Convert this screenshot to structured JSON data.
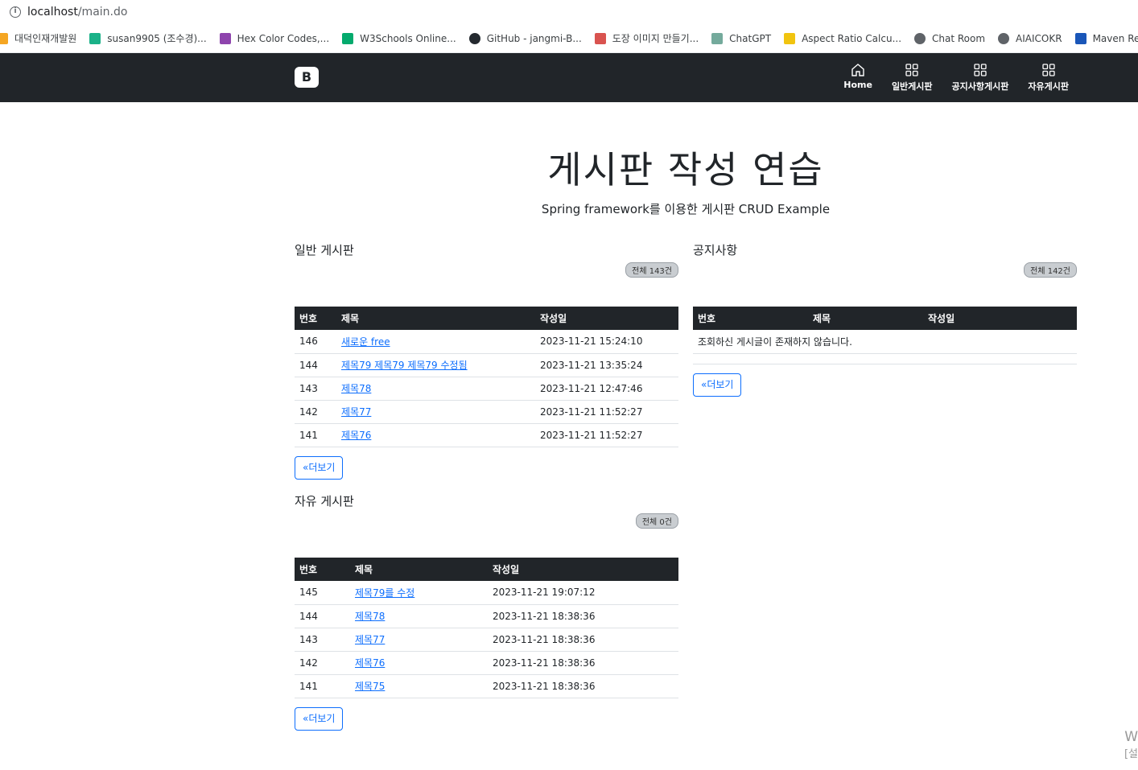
{
  "browser": {
    "url_host": "localhost",
    "url_path": "/main.do"
  },
  "bookmarks": [
    {
      "label": "대덕인재개발원",
      "icon": "bookmark-diagonal-icon",
      "color": "#f5a623"
    },
    {
      "label": "susan9905 (조수경)...",
      "icon": "v-icon",
      "color": "#1ab188"
    },
    {
      "label": "Hex Color Codes,...",
      "icon": "palette-icon",
      "color": "#8e44ad"
    },
    {
      "label": "W3Schools Online...",
      "icon": "w3-icon",
      "color": "#04aa6d"
    },
    {
      "label": "GitHub - jangmi-B...",
      "icon": "github-icon",
      "color": "#24292f"
    },
    {
      "label": "도장 이미지 만들기...",
      "icon": "stamp-icon",
      "color": "#d9534f"
    },
    {
      "label": "ChatGPT",
      "icon": "chatgpt-icon",
      "color": "#74aa9c"
    },
    {
      "label": "Aspect Ratio Calcu...",
      "icon": "aspect-icon",
      "color": "#f1c40f"
    },
    {
      "label": "Chat Room",
      "icon": "globe-icon",
      "color": "#5f6368"
    },
    {
      "label": "AIAICOKR",
      "icon": "globe-icon",
      "color": "#5f6368"
    },
    {
      "label": "Maven Reposito",
      "icon": "maven-icon",
      "color": "#1a56b8"
    }
  ],
  "nav": {
    "brand": "B",
    "links": [
      {
        "label": "Home",
        "icon": "house-icon"
      },
      {
        "label": "일반게시판",
        "icon": "grid-icon"
      },
      {
        "label": "공지사항게시판",
        "icon": "grid-icon"
      },
      {
        "label": "자유게시판",
        "icon": "grid-icon"
      }
    ]
  },
  "hero": {
    "title": "게시판 작성 연습",
    "subtitle": "Spring framework를 이용한 게시판 CRUD Example"
  },
  "general": {
    "title": "일반 게시판",
    "badge": "전체 143건",
    "headers": [
      "번호",
      "제목",
      "작성일"
    ],
    "rows": [
      [
        "146",
        "새로운 free",
        "2023-11-21 15:24:10"
      ],
      [
        "144",
        "제목79 제목79 제목79 수정됨",
        "2023-11-21 13:35:24"
      ],
      [
        "143",
        "제목78",
        "2023-11-21 12:47:46"
      ],
      [
        "142",
        "제목77",
        "2023-11-21 11:52:27"
      ],
      [
        "141",
        "제목76",
        "2023-11-21 11:52:27"
      ]
    ],
    "more": "«더보기"
  },
  "notice": {
    "title": "공지사항",
    "badge": "전체 142건",
    "headers": [
      "번호",
      "제목",
      "작성일"
    ],
    "empty": "조회하신 게시글이 존재하지 않습니다.",
    "more": "«더보기"
  },
  "free": {
    "title": "자유 게시판",
    "badge": "전체 0건",
    "headers": [
      "번호",
      "제목",
      "작성일"
    ],
    "rows": [
      [
        "145",
        "제목79를 수정",
        "2023-11-21 19:07:12"
      ],
      [
        "144",
        "제목78",
        "2023-11-21 18:38:36"
      ],
      [
        "143",
        "제목77",
        "2023-11-21 18:38:36"
      ],
      [
        "142",
        "제목76",
        "2023-11-21 18:38:36"
      ],
      [
        "141",
        "제목75",
        "2023-11-21 18:38:36"
      ]
    ],
    "more": "«더보기"
  },
  "watermark": {
    "line1": "W",
    "line2": "[설"
  }
}
